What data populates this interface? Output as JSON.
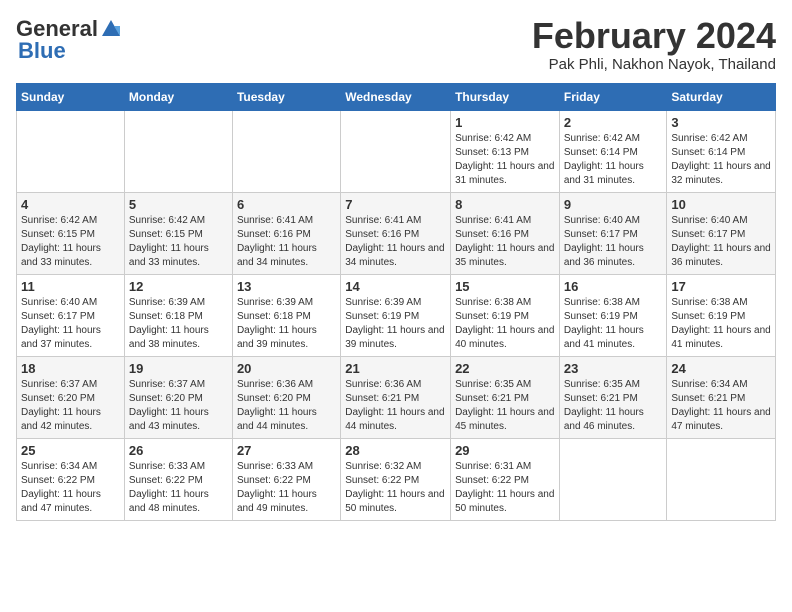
{
  "header": {
    "logo_line1": "General",
    "logo_line2": "Blue",
    "month": "February 2024",
    "location": "Pak Phli, Nakhon Nayok, Thailand"
  },
  "days_of_week": [
    "Sunday",
    "Monday",
    "Tuesday",
    "Wednesday",
    "Thursday",
    "Friday",
    "Saturday"
  ],
  "weeks": [
    [
      {
        "day": "",
        "sunrise": "",
        "sunset": "",
        "daylight": ""
      },
      {
        "day": "",
        "sunrise": "",
        "sunset": "",
        "daylight": ""
      },
      {
        "day": "",
        "sunrise": "",
        "sunset": "",
        "daylight": ""
      },
      {
        "day": "",
        "sunrise": "",
        "sunset": "",
        "daylight": ""
      },
      {
        "day": "1",
        "sunrise": "Sunrise: 6:42 AM",
        "sunset": "Sunset: 6:13 PM",
        "daylight": "Daylight: 11 hours and 31 minutes."
      },
      {
        "day": "2",
        "sunrise": "Sunrise: 6:42 AM",
        "sunset": "Sunset: 6:14 PM",
        "daylight": "Daylight: 11 hours and 31 minutes."
      },
      {
        "day": "3",
        "sunrise": "Sunrise: 6:42 AM",
        "sunset": "Sunset: 6:14 PM",
        "daylight": "Daylight: 11 hours and 32 minutes."
      }
    ],
    [
      {
        "day": "4",
        "sunrise": "Sunrise: 6:42 AM",
        "sunset": "Sunset: 6:15 PM",
        "daylight": "Daylight: 11 hours and 33 minutes."
      },
      {
        "day": "5",
        "sunrise": "Sunrise: 6:42 AM",
        "sunset": "Sunset: 6:15 PM",
        "daylight": "Daylight: 11 hours and 33 minutes."
      },
      {
        "day": "6",
        "sunrise": "Sunrise: 6:41 AM",
        "sunset": "Sunset: 6:16 PM",
        "daylight": "Daylight: 11 hours and 34 minutes."
      },
      {
        "day": "7",
        "sunrise": "Sunrise: 6:41 AM",
        "sunset": "Sunset: 6:16 PM",
        "daylight": "Daylight: 11 hours and 34 minutes."
      },
      {
        "day": "8",
        "sunrise": "Sunrise: 6:41 AM",
        "sunset": "Sunset: 6:16 PM",
        "daylight": "Daylight: 11 hours and 35 minutes."
      },
      {
        "day": "9",
        "sunrise": "Sunrise: 6:40 AM",
        "sunset": "Sunset: 6:17 PM",
        "daylight": "Daylight: 11 hours and 36 minutes."
      },
      {
        "day": "10",
        "sunrise": "Sunrise: 6:40 AM",
        "sunset": "Sunset: 6:17 PM",
        "daylight": "Daylight: 11 hours and 36 minutes."
      }
    ],
    [
      {
        "day": "11",
        "sunrise": "Sunrise: 6:40 AM",
        "sunset": "Sunset: 6:17 PM",
        "daylight": "Daylight: 11 hours and 37 minutes."
      },
      {
        "day": "12",
        "sunrise": "Sunrise: 6:39 AM",
        "sunset": "Sunset: 6:18 PM",
        "daylight": "Daylight: 11 hours and 38 minutes."
      },
      {
        "day": "13",
        "sunrise": "Sunrise: 6:39 AM",
        "sunset": "Sunset: 6:18 PM",
        "daylight": "Daylight: 11 hours and 39 minutes."
      },
      {
        "day": "14",
        "sunrise": "Sunrise: 6:39 AM",
        "sunset": "Sunset: 6:19 PM",
        "daylight": "Daylight: 11 hours and 39 minutes."
      },
      {
        "day": "15",
        "sunrise": "Sunrise: 6:38 AM",
        "sunset": "Sunset: 6:19 PM",
        "daylight": "Daylight: 11 hours and 40 minutes."
      },
      {
        "day": "16",
        "sunrise": "Sunrise: 6:38 AM",
        "sunset": "Sunset: 6:19 PM",
        "daylight": "Daylight: 11 hours and 41 minutes."
      },
      {
        "day": "17",
        "sunrise": "Sunrise: 6:38 AM",
        "sunset": "Sunset: 6:19 PM",
        "daylight": "Daylight: 11 hours and 41 minutes."
      }
    ],
    [
      {
        "day": "18",
        "sunrise": "Sunrise: 6:37 AM",
        "sunset": "Sunset: 6:20 PM",
        "daylight": "Daylight: 11 hours and 42 minutes."
      },
      {
        "day": "19",
        "sunrise": "Sunrise: 6:37 AM",
        "sunset": "Sunset: 6:20 PM",
        "daylight": "Daylight: 11 hours and 43 minutes."
      },
      {
        "day": "20",
        "sunrise": "Sunrise: 6:36 AM",
        "sunset": "Sunset: 6:20 PM",
        "daylight": "Daylight: 11 hours and 44 minutes."
      },
      {
        "day": "21",
        "sunrise": "Sunrise: 6:36 AM",
        "sunset": "Sunset: 6:21 PM",
        "daylight": "Daylight: 11 hours and 44 minutes."
      },
      {
        "day": "22",
        "sunrise": "Sunrise: 6:35 AM",
        "sunset": "Sunset: 6:21 PM",
        "daylight": "Daylight: 11 hours and 45 minutes."
      },
      {
        "day": "23",
        "sunrise": "Sunrise: 6:35 AM",
        "sunset": "Sunset: 6:21 PM",
        "daylight": "Daylight: 11 hours and 46 minutes."
      },
      {
        "day": "24",
        "sunrise": "Sunrise: 6:34 AM",
        "sunset": "Sunset: 6:21 PM",
        "daylight": "Daylight: 11 hours and 47 minutes."
      }
    ],
    [
      {
        "day": "25",
        "sunrise": "Sunrise: 6:34 AM",
        "sunset": "Sunset: 6:22 PM",
        "daylight": "Daylight: 11 hours and 47 minutes."
      },
      {
        "day": "26",
        "sunrise": "Sunrise: 6:33 AM",
        "sunset": "Sunset: 6:22 PM",
        "daylight": "Daylight: 11 hours and 48 minutes."
      },
      {
        "day": "27",
        "sunrise": "Sunrise: 6:33 AM",
        "sunset": "Sunset: 6:22 PM",
        "daylight": "Daylight: 11 hours and 49 minutes."
      },
      {
        "day": "28",
        "sunrise": "Sunrise: 6:32 AM",
        "sunset": "Sunset: 6:22 PM",
        "daylight": "Daylight: 11 hours and 50 minutes."
      },
      {
        "day": "29",
        "sunrise": "Sunrise: 6:31 AM",
        "sunset": "Sunset: 6:22 PM",
        "daylight": "Daylight: 11 hours and 50 minutes."
      },
      {
        "day": "",
        "sunrise": "",
        "sunset": "",
        "daylight": ""
      },
      {
        "day": "",
        "sunrise": "",
        "sunset": "",
        "daylight": ""
      }
    ]
  ]
}
